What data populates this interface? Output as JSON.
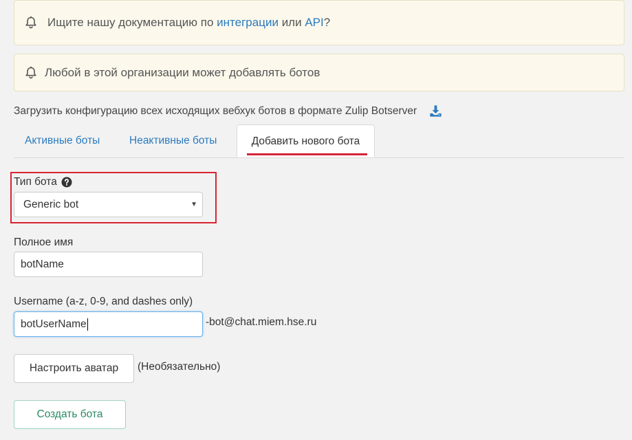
{
  "notices": {
    "docs": {
      "prefix": "Ищите нашу документацию по",
      "link_integrations": "интеграции",
      "middle": "или",
      "link_api": "API",
      "suffix": "?"
    },
    "permission": "Любой в этой организации может добавлять ботов"
  },
  "download": {
    "label": "Загрузить конфигурацию всех исходящих вебхук ботов в формате Zulip Botserver",
    "icon": "download-icon"
  },
  "tabs": [
    {
      "label": "Активные боты",
      "active": false
    },
    {
      "label": "Неактивные боты",
      "active": false
    },
    {
      "label": "Добавить нового бота",
      "active": true
    }
  ],
  "form": {
    "bot_type": {
      "label": "Тип бота",
      "value": "Generic bot",
      "help_icon": "question-circle-icon"
    },
    "full_name": {
      "label": "Полное имя",
      "value": "botName"
    },
    "username": {
      "label": "Username (a-z, 0-9, and dashes only)",
      "value": "botUserName",
      "suffix": "-bot@chat.miem.hse.ru"
    },
    "avatar": {
      "button_label": "Настроить аватар",
      "optional_text": "(Необязательно)"
    },
    "submit_label": "Создать бота"
  },
  "colors": {
    "link": "#2a7bbf",
    "active_tab_underline": "#d4243b",
    "highlight_box": "#d9232f",
    "create_button_text": "#2a8a63",
    "notice_background": "#fcf8ec"
  }
}
